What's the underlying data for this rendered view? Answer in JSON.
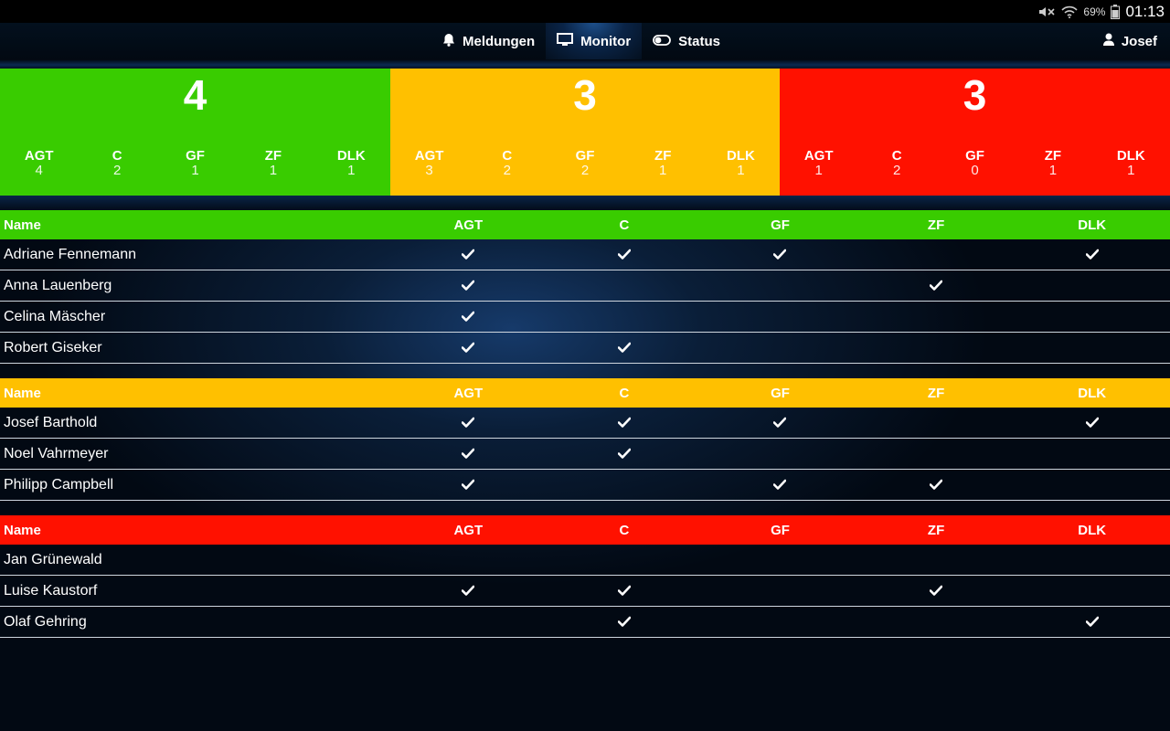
{
  "status_bar": {
    "battery": "69%",
    "time": "01:13"
  },
  "nav": {
    "tabs": [
      {
        "label": "Meldungen",
        "icon": "bell-icon",
        "active": false
      },
      {
        "label": "Monitor",
        "icon": "monitor-icon",
        "active": true
      },
      {
        "label": "Status",
        "icon": "toggle-icon",
        "active": false
      }
    ],
    "user": {
      "label": "Josef",
      "icon": "user-icon"
    }
  },
  "columns": [
    "AGT",
    "C",
    "GF",
    "ZF",
    "DLK"
  ],
  "summary": [
    {
      "color": "#39cc00",
      "count": "4",
      "values": [
        "4",
        "2",
        "1",
        "1",
        "1"
      ]
    },
    {
      "color": "#ffc000",
      "count": "3",
      "values": [
        "3",
        "2",
        "2",
        "1",
        "1"
      ]
    },
    {
      "color": "#ff1100",
      "count": "3",
      "values": [
        "1",
        "2",
        "0",
        "1",
        "1"
      ]
    }
  ],
  "groups": [
    {
      "color": "#39cc00",
      "name_header": "Name",
      "rows": [
        {
          "name": "Adriane Fennemann",
          "checks": [
            true,
            true,
            true,
            false,
            true
          ]
        },
        {
          "name": "Anna Lauenberg",
          "checks": [
            true,
            false,
            false,
            true,
            false
          ]
        },
        {
          "name": "Celina Mäscher",
          "checks": [
            true,
            false,
            false,
            false,
            false
          ]
        },
        {
          "name": "Robert Giseker",
          "checks": [
            true,
            true,
            false,
            false,
            false
          ]
        }
      ]
    },
    {
      "color": "#ffc000",
      "name_header": "Name",
      "rows": [
        {
          "name": "Josef Barthold",
          "checks": [
            true,
            true,
            true,
            false,
            true
          ]
        },
        {
          "name": "Noel Vahrmeyer",
          "checks": [
            true,
            true,
            false,
            false,
            false
          ]
        },
        {
          "name": "Philipp Campbell",
          "checks": [
            true,
            false,
            true,
            true,
            false
          ]
        }
      ]
    },
    {
      "color": "#ff1100",
      "name_header": "Name",
      "rows": [
        {
          "name": "Jan Grünewald",
          "checks": [
            false,
            false,
            false,
            false,
            false
          ]
        },
        {
          "name": "Luise Kaustorf",
          "checks": [
            true,
            true,
            false,
            true,
            false
          ]
        },
        {
          "name": "Olaf Gehring",
          "checks": [
            false,
            true,
            false,
            false,
            true
          ]
        }
      ]
    }
  ]
}
